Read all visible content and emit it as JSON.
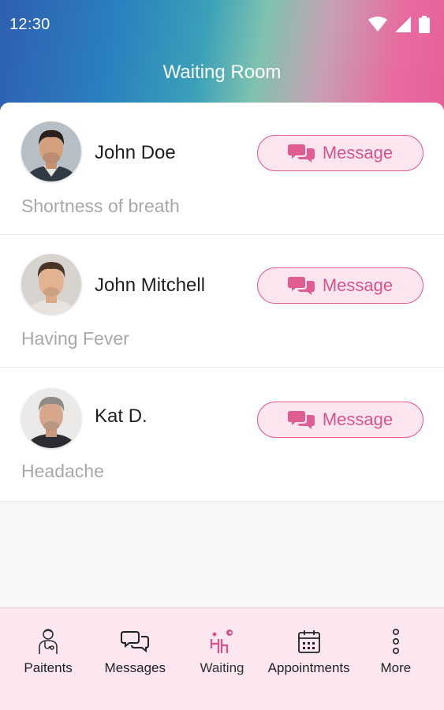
{
  "status_bar": {
    "time": "12:30"
  },
  "header": {
    "title": "Waiting Room"
  },
  "colors": {
    "accent": "#e05d93",
    "accent_light": "#fbe6ef",
    "nav_bg": "#fce6ef"
  },
  "patients": [
    {
      "name": "John Doe",
      "complaint": "Shortness of breath",
      "button_label": "Message"
    },
    {
      "name": "John Mitchell",
      "complaint": "Having Fever",
      "button_label": "Message"
    },
    {
      "name": "Kat D.",
      "complaint": "Headache",
      "button_label": "Message"
    }
  ],
  "nav": [
    {
      "label": "Paitents",
      "icon": "doctor-icon"
    },
    {
      "label": "Messages",
      "icon": "chat-icon"
    },
    {
      "label": "Waiting",
      "icon": "waiting-icon",
      "active": true
    },
    {
      "label": "Appointments",
      "icon": "calendar-icon"
    },
    {
      "label": "More",
      "icon": "more-vertical-icon"
    }
  ]
}
